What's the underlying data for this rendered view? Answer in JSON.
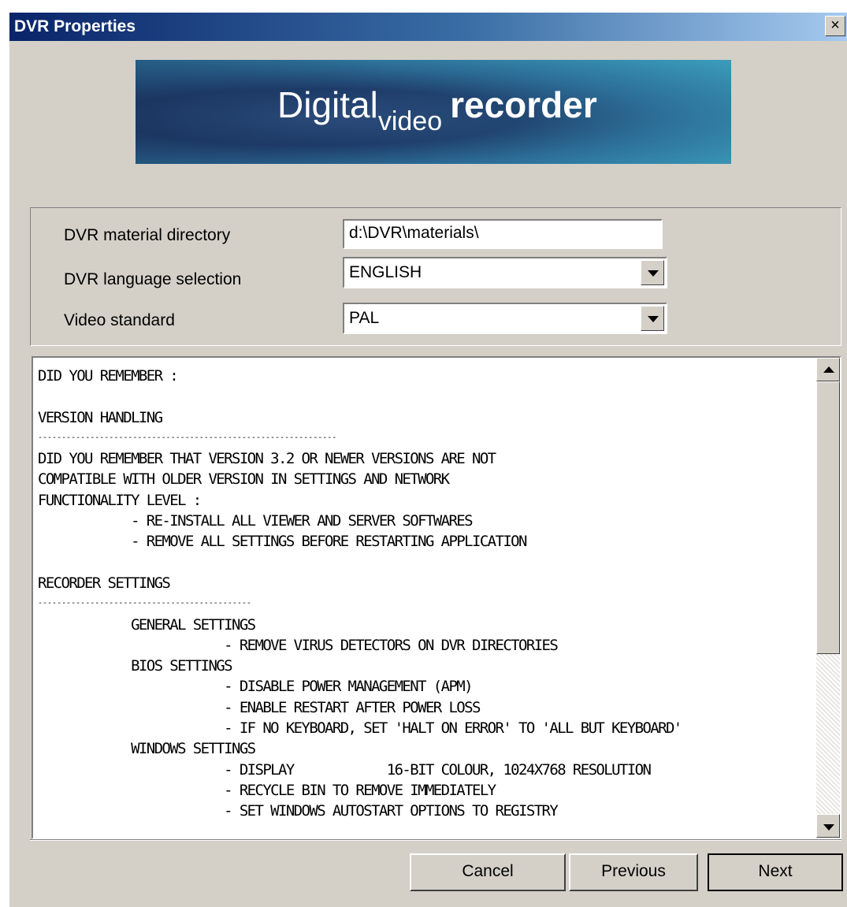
{
  "window": {
    "title": "DVR Properties",
    "close_label": "×"
  },
  "banner": {
    "part1": "Digital",
    "part2": "video",
    "part3": "recorder"
  },
  "form": {
    "material_directory": {
      "label": "DVR material directory",
      "value": "d:\\DVR\\materials\\"
    },
    "language": {
      "label": "DVR language selection",
      "value": "ENGLISH"
    },
    "video_standard": {
      "label": "Video standard",
      "value": "PAL"
    }
  },
  "memo": {
    "lines": [
      "DID YOU REMEMBER :",
      "",
      "VERSION HANDLING",
      "---------------------------------------------------------------",
      "DID YOU REMEMBER THAT VERSION 3.2 OR NEWER VERSIONS ARE NOT",
      "COMPATIBLE WITH OLDER VERSION IN SETTINGS AND NETWORK",
      "FUNCTIONALITY LEVEL :",
      "            - RE-INSTALL ALL VIEWER AND SERVER SOFTWARES",
      "            - REMOVE ALL SETTINGS BEFORE RESTARTING APPLICATION",
      "",
      "RECORDER SETTINGS",
      "---------------------------------------------",
      "            GENERAL SETTINGS",
      "                        - REMOVE VIRUS DETECTORS ON DVR DIRECTORIES",
      "            BIOS SETTINGS",
      "                        - DISABLE POWER MANAGEMENT (APM)",
      "                        - ENABLE RESTART AFTER POWER LOSS",
      "                        - IF NO KEYBOARD, SET 'HALT ON ERROR' TO 'ALL BUT KEYBOARD'",
      "            WINDOWS SETTINGS",
      "                        - DISPLAY            16-BIT COLOUR, 1024X768 RESOLUTION",
      "                        - RECYCLE BIN TO REMOVE IMMEDIATELY",
      "                        - SET WINDOWS AUTOSTART OPTIONS TO REGISTRY"
    ]
  },
  "buttons": {
    "cancel": "Cancel",
    "previous": "Previous",
    "next": "Next"
  }
}
